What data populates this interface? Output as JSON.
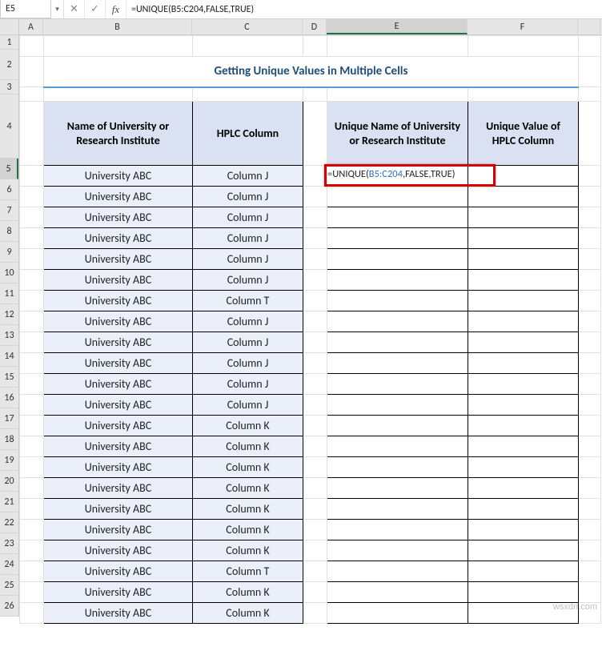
{
  "nameBox": "E5",
  "formulaBar": "=UNIQUE(B5:C204,FALSE,TRUE)",
  "columns": [
    "A",
    "B",
    "C",
    "D",
    "E",
    "F"
  ],
  "rows": [
    "1",
    "2",
    "3",
    "4",
    "5",
    "6",
    "7",
    "8",
    "9",
    "10",
    "11",
    "12",
    "13",
    "14",
    "15",
    "16",
    "17",
    "18",
    "19",
    "20",
    "21",
    "22",
    "23",
    "24",
    "25",
    "26"
  ],
  "selectedCol": "E",
  "selectedRow": "5",
  "title": "Getting Unique Values in Multiple Cells",
  "headers": {
    "b": "Name of University or Research Institute",
    "c": "HPLC Column",
    "e": "Unique Name of University or Research Institute",
    "f": "Unique Value of HPLC Column"
  },
  "data": [
    {
      "b": "University ABC",
      "c": "Column J"
    },
    {
      "b": "University ABC",
      "c": "Column J"
    },
    {
      "b": "University ABC",
      "c": "Column J"
    },
    {
      "b": "University ABC",
      "c": "Column J"
    },
    {
      "b": "University ABC",
      "c": "Column J"
    },
    {
      "b": "University ABC",
      "c": "Column J"
    },
    {
      "b": "University ABC",
      "c": "Column T"
    },
    {
      "b": "University ABC",
      "c": "Column J"
    },
    {
      "b": "University ABC",
      "c": "Column J"
    },
    {
      "b": "University ABC",
      "c": "Column J"
    },
    {
      "b": "University ABC",
      "c": "Column J"
    },
    {
      "b": "University ABC",
      "c": "Column J"
    },
    {
      "b": "University ABC",
      "c": "Column K"
    },
    {
      "b": "University ABC",
      "c": "Column K"
    },
    {
      "b": "University ABC",
      "c": "Column K"
    },
    {
      "b": "University ABC",
      "c": "Column K"
    },
    {
      "b": "University ABC",
      "c": "Column K"
    },
    {
      "b": "University ABC",
      "c": "Column K"
    },
    {
      "b": "University ABC",
      "c": "Column K"
    },
    {
      "b": "University ABC",
      "c": "Column T"
    },
    {
      "b": "University ABC",
      "c": "Column K"
    },
    {
      "b": "University ABC",
      "c": "Column K"
    }
  ],
  "cellFormula": {
    "prefix": "=UNIQUE(",
    "ref": "B5:C204",
    "suffix": ",FALSE,TRUE)"
  },
  "watermark": "wsxdn.com"
}
